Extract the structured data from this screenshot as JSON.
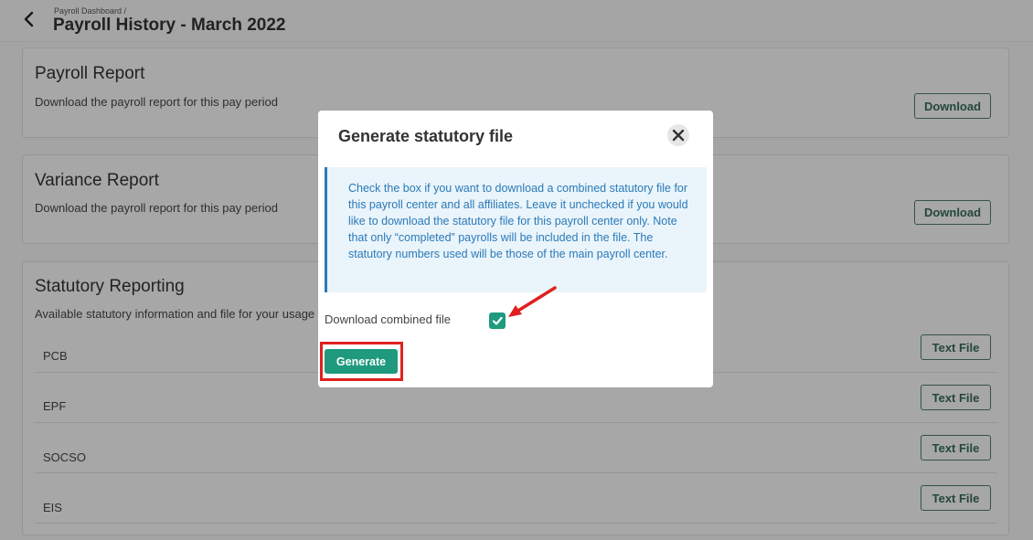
{
  "header": {
    "breadcrumb": "Payroll Dashboard /",
    "title": "Payroll History - March 2022"
  },
  "cards": {
    "payroll": {
      "title": "Payroll Report",
      "desc": "Download the payroll report for this pay period",
      "button": "Download"
    },
    "variance": {
      "title": "Variance Report",
      "desc": "Download the payroll report for this pay period",
      "button": "Download"
    },
    "statutory": {
      "title": "Statutory Reporting",
      "desc": "Available statutory information and file for your usage",
      "rows": [
        {
          "name": "PCB",
          "button": "Text File"
        },
        {
          "name": "EPF",
          "button": "Text File"
        },
        {
          "name": "SOCSO",
          "button": "Text File"
        },
        {
          "name": "EIS",
          "button": "Text File"
        }
      ]
    }
  },
  "modal": {
    "title": "Generate statutory file",
    "info": "Check the box if you want to download a combined statutory file for this payroll center and all affiliates. Leave it unchecked if you would like to download the statutory file for this payroll center only. Note that only “completed” payrolls will be included in the file. The statutory numbers used will be those of the main payroll center.",
    "checkbox_label": "Download combined file",
    "checkbox_checked": true,
    "generate_label": "Generate"
  },
  "colors": {
    "accent": "#1f9a7e",
    "outline_button": "#35695c",
    "info_text": "#2a7ab8",
    "annotation": "#e02020"
  },
  "icons": {
    "back": "chevron-left-icon",
    "close": "close-icon",
    "check": "checkmark-icon",
    "arrow": "annotation-arrow-icon"
  }
}
